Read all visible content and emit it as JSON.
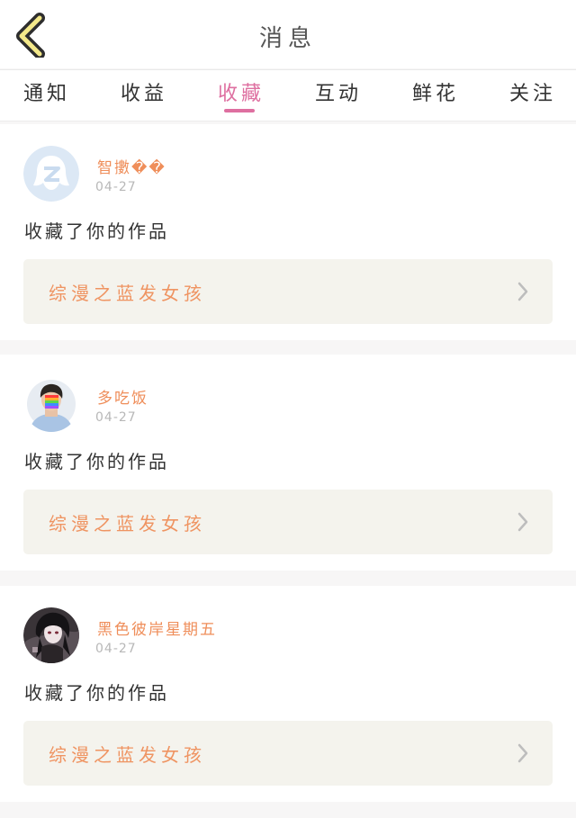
{
  "header": {
    "title": "消息"
  },
  "tabs": [
    {
      "label": "通知",
      "active": false
    },
    {
      "label": "收益",
      "active": false
    },
    {
      "label": "收藏",
      "active": true
    },
    {
      "label": "互动",
      "active": false
    },
    {
      "label": "鲜花",
      "active": false
    },
    {
      "label": "关注",
      "active": false
    }
  ],
  "colors": {
    "accent": "#de6fa0",
    "username": "#ef8e5a",
    "work_title": "#ef9462"
  },
  "messages": [
    {
      "username": "智擻��",
      "date": "04-27",
      "action": "收藏了你的作品",
      "work_title": "综漫之蓝发女孩",
      "avatar_icon": "qq-logo-avatar"
    },
    {
      "username": "多吃饭",
      "date": "04-27",
      "action": "收藏了你的作品",
      "work_title": "综漫之蓝发女孩",
      "avatar_icon": "boy-photo-avatar"
    },
    {
      "username": "黑色彼岸星期五",
      "date": "04-27",
      "action": "收藏了你的作品",
      "work_title": "综漫之蓝发女孩",
      "avatar_icon": "anime-character-avatar"
    }
  ]
}
